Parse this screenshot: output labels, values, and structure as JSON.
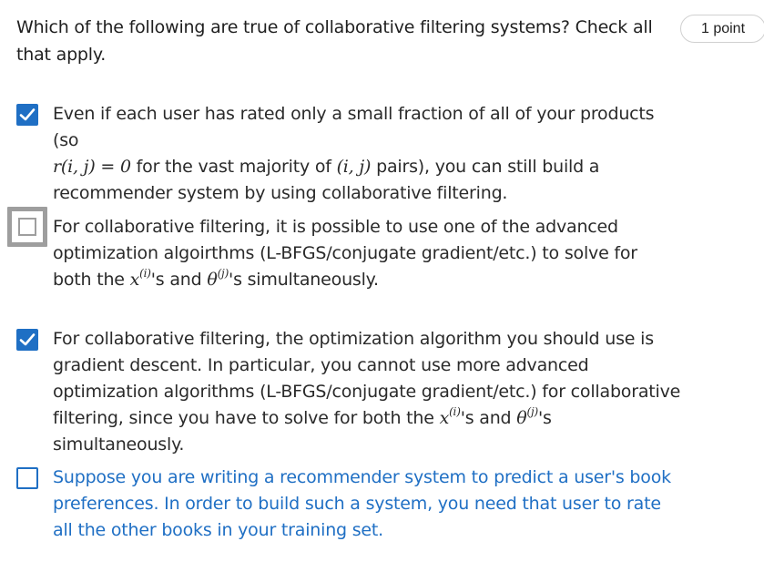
{
  "question": {
    "text": "Which of the following are true of collaborative filtering systems? Check all that apply.",
    "points": "1 point"
  },
  "options": [
    {
      "checked": true,
      "t1": "Even if each user has rated only a small fraction of all of your products (so",
      "m1": "r(i, j) = 0",
      "t2": " for the vast majority of ",
      "m2": "(i, j)",
      "t3": " pairs), you can still build a recommender system by using collaborative filtering."
    },
    {
      "checked": false,
      "focused": true,
      "t1": "For collaborative filtering, it is possible to use one of the advanced optimization algoirthms (L-BFGS/conjugate gradient/etc.) to solve for both the ",
      "m1": "x",
      "s1": "(i)",
      "t2": "'s and ",
      "m2": "θ",
      "s2": "(j)",
      "t3": "'s simultaneously."
    },
    {
      "checked": true,
      "t1": "For collaborative filtering, the optimization algorithm you should use is gradient descent. In particular, you cannot use more advanced optimization algorithms (L-BFGS/conjugate gradient/etc.) for collaborative filtering, since you have to solve for both the ",
      "m1": "x",
      "s1": "(i)",
      "t2": "'s and ",
      "m2": "θ",
      "s2": "(j)",
      "t3": "'s simultaneously."
    },
    {
      "checked": false,
      "t1": "Suppose you are writing a recommender system to predict a user's book preferences. In order to build such a system, you need that user to rate all the other books in your training set."
    }
  ],
  "colors": {
    "accent": "#1f6fc4",
    "focus_border": "#9e9e9e",
    "text": "#1f1f1f"
  }
}
